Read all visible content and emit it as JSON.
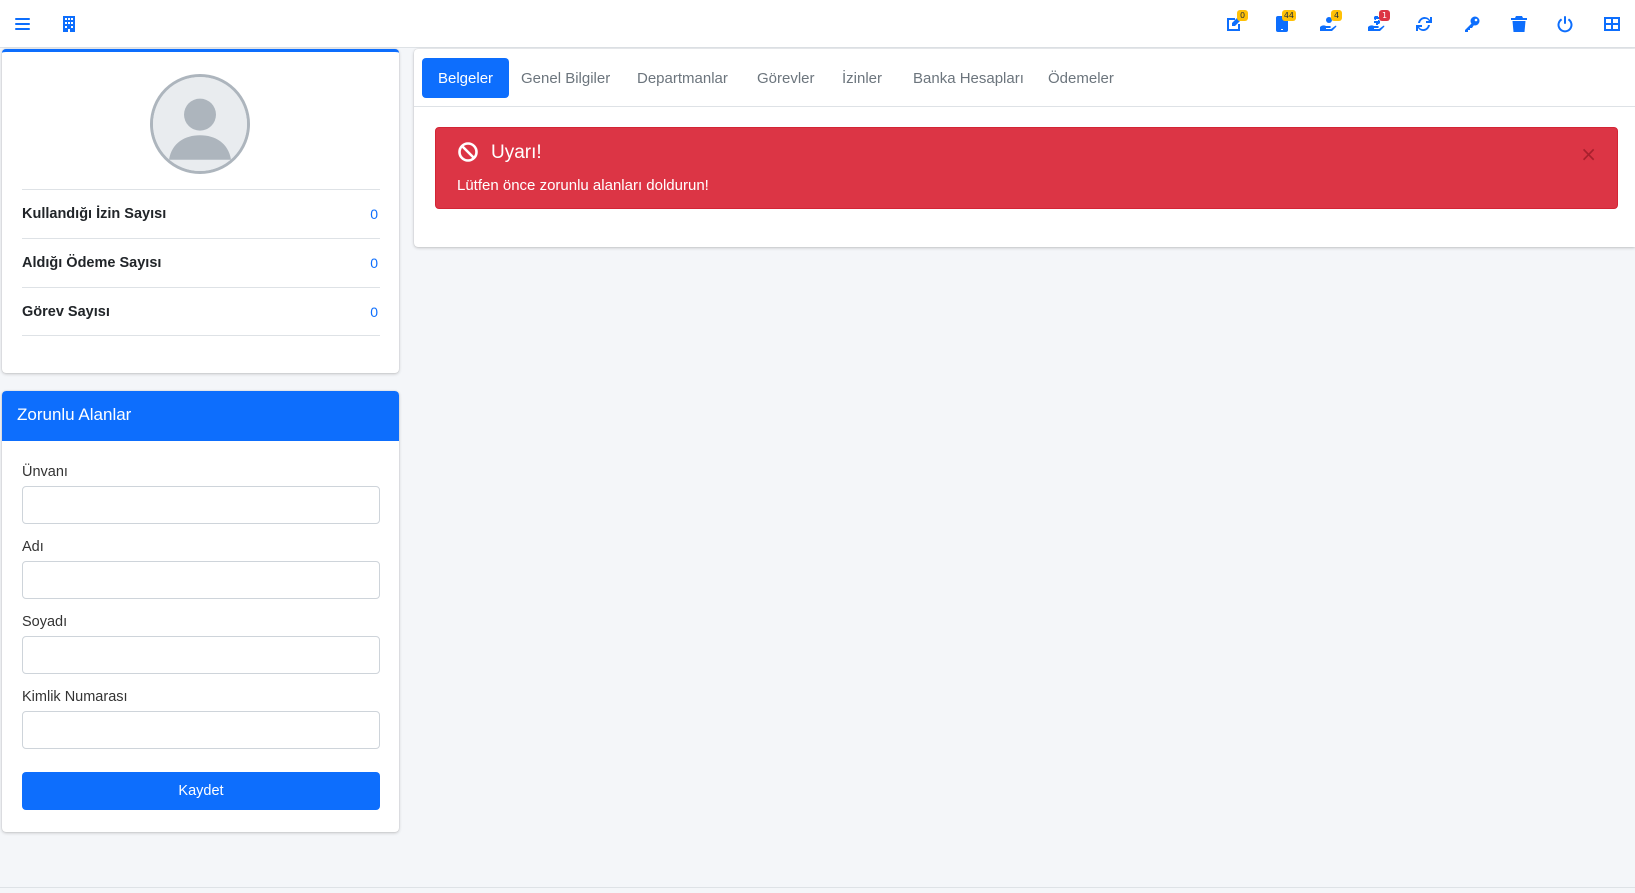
{
  "navbar": {
    "left_icons": [
      "menu-icon",
      "building-icon"
    ],
    "right_icons": [
      {
        "name": "document-edit-icon",
        "badge": "0",
        "badge_color": "#ffc107"
      },
      {
        "name": "tablet-icon",
        "badge": "44",
        "badge_color": "#ffc107"
      },
      {
        "name": "hand-holding-icon",
        "badge": "4",
        "badge_color": "#ffc107"
      },
      {
        "name": "hand-holding-usd-icon",
        "badge": "1",
        "badge_color": "#dc3545"
      },
      {
        "name": "refresh-icon"
      },
      {
        "name": "key-icon"
      },
      {
        "name": "trash-icon"
      },
      {
        "name": "power-icon"
      },
      {
        "name": "grid-icon"
      }
    ]
  },
  "profile": {
    "avatar": "user-avatar-icon",
    "stats": [
      {
        "label": "Kullandığı İzin Sayısı",
        "value": "0"
      },
      {
        "label": "Aldığı Ödeme Sayısı",
        "value": "0"
      },
      {
        "label": "Görev Sayısı",
        "value": "0"
      }
    ]
  },
  "required_fields": {
    "title": "Zorunlu Alanlar",
    "fields": [
      {
        "label": "Ünvanı",
        "value": ""
      },
      {
        "label": "Adı",
        "value": ""
      },
      {
        "label": "Soyadı",
        "value": ""
      },
      {
        "label": "Kimlik Numarası",
        "value": ""
      }
    ],
    "save_label": "Kaydet"
  },
  "tabs": [
    {
      "label": "Belgeler",
      "active": true
    },
    {
      "label": "Genel Bilgiler",
      "active": false
    },
    {
      "label": "Departmanlar",
      "active": false
    },
    {
      "label": "Görevler",
      "active": false
    },
    {
      "label": "İzinler",
      "active": false
    },
    {
      "label": "Banka Hesapları",
      "active": false
    },
    {
      "label": "Ödemeler",
      "active": false
    }
  ],
  "alert": {
    "title": "Uyarı!",
    "message": "Lütfen önce zorunlu alanları doldurun!",
    "close": "×",
    "color": "#dc3545"
  },
  "colors": {
    "primary": "#0d6efd",
    "danger": "#dc3545",
    "warning": "#ffc107"
  }
}
